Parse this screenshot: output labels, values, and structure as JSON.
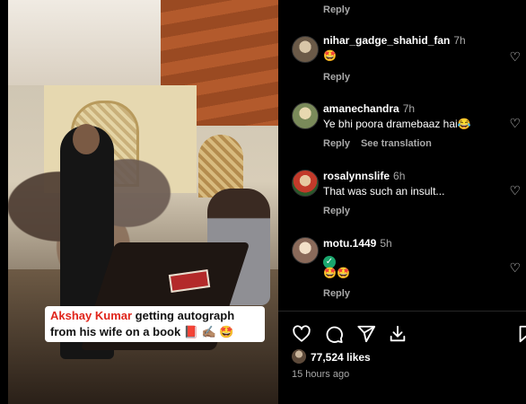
{
  "media": {
    "caption_name": "Akshay Kumar",
    "caption_rest": " getting autograph from his wife on a book",
    "caption_emoji": " 📕 ✍🏽 🤩"
  },
  "top_reply": "Reply",
  "comments": [
    {
      "username": "nihar_gadge_shahid_fan",
      "time": "7h",
      "text": "🤩",
      "reply": "Reply",
      "see_translation": ""
    },
    {
      "username": "amanechandra",
      "time": "7h",
      "text": "Ye bhi poora dramebaaz hai😂",
      "reply": "Reply",
      "see_translation": "See translation"
    },
    {
      "username": "rosalynnslife",
      "time": "6h",
      "text": "That was such an insult...",
      "reply": "Reply",
      "see_translation": ""
    },
    {
      "username": "motu.1449",
      "time": "5h",
      "badge": "✓",
      "text": "🤩🤩",
      "reply": "Reply",
      "see_translation": ""
    }
  ],
  "icons": {
    "comment_like": "heart-icon",
    "like": "heart-icon",
    "comment": "comment-icon",
    "share": "share-icon",
    "save": "save-icon",
    "bookmark": "bookmark-icon"
  },
  "likes": "77,524 likes",
  "posted": "15 hours ago",
  "colors": {
    "caption_name": "#e0251b",
    "verified": "#1aa66d"
  }
}
